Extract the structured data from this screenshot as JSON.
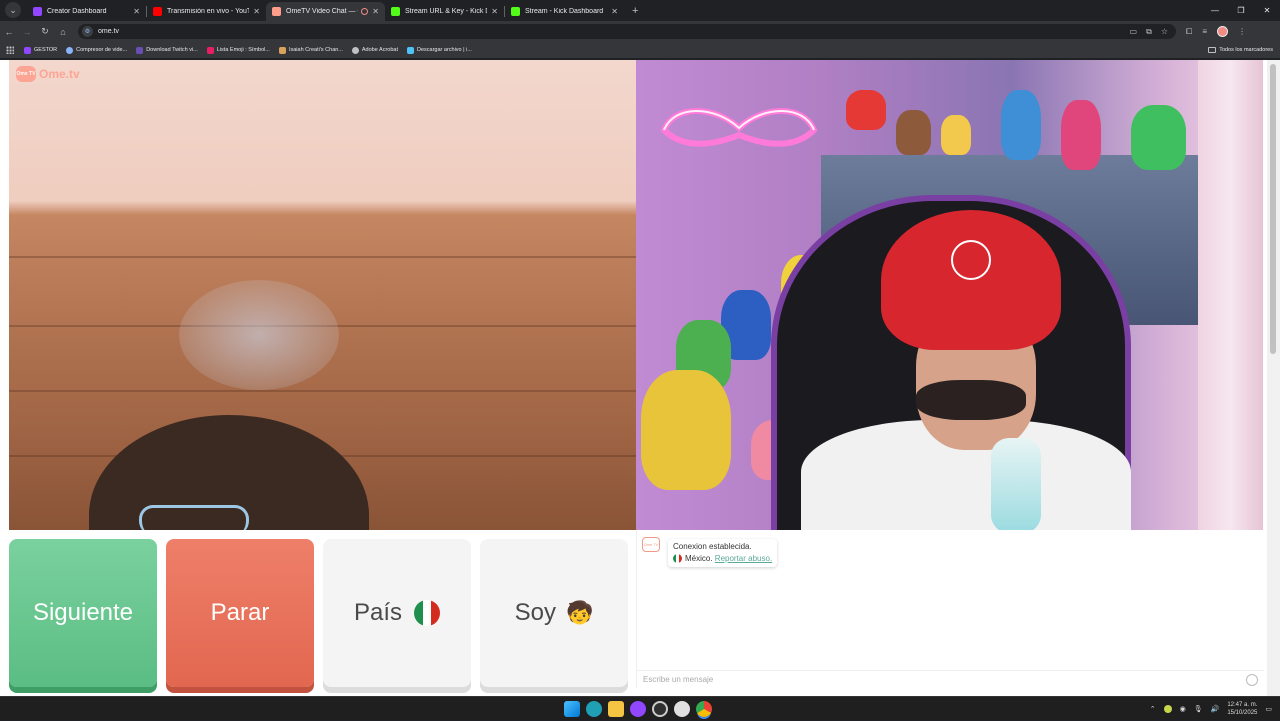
{
  "browser": {
    "tabs": [
      {
        "title": "Creator Dashboard",
        "favicon_color": "#9146ff",
        "active": false
      },
      {
        "title": "Transmisión en vivo - YouTube",
        "favicon_color": "#ff0000",
        "active": false
      },
      {
        "title": "OmeTV Video Chat — Ome",
        "favicon_color": "#ff9d8b",
        "active": true
      },
      {
        "title": "Stream URL & Key - Kick Dashb",
        "favicon_color": "#53fc18",
        "active": false
      },
      {
        "title": "Stream - Kick Dashboard",
        "favicon_color": "#53fc18",
        "active": false
      }
    ],
    "url": "ome.tv",
    "bookmarks": [
      {
        "label": "GESTOR",
        "color": "#9146ff"
      },
      {
        "label": "Compresor de vide...",
        "color": "#8ab4f8"
      },
      {
        "label": "Download Twitch vi...",
        "color": "#6a4fb3"
      },
      {
        "label": "Lista Emoji : Símbol...",
        "color": "#e91e63"
      },
      {
        "label": "Isaiah Creati's Chan...",
        "color": "#d9a35b"
      },
      {
        "label": "Adobe Acrobat",
        "color": "#bdc1c6"
      },
      {
        "label": "Descargar archivo | i...",
        "color": "#4fc3f7"
      }
    ],
    "bookmarks_folder": "Todos los marcadores"
  },
  "app": {
    "brand": "Ome.tv",
    "brand_icon_text": "Ome TV",
    "buttons": {
      "next": "Siguiente",
      "stop": "Parar",
      "country": "País",
      "gender": "Soy",
      "gender_emoji": "🧒"
    },
    "colors": {
      "next": "#5bbd83",
      "stop": "#e26750",
      "report_link": "#5aa99a"
    },
    "chat": {
      "avatar_text": "Ome TV",
      "status": "Conexion establecida.",
      "country": "México.",
      "report_link": "Reportar abuso.",
      "input_placeholder": "Escribe un mensaje"
    }
  },
  "taskbar": {
    "time": "12:47 a. m.",
    "date": "15/10/2025"
  }
}
